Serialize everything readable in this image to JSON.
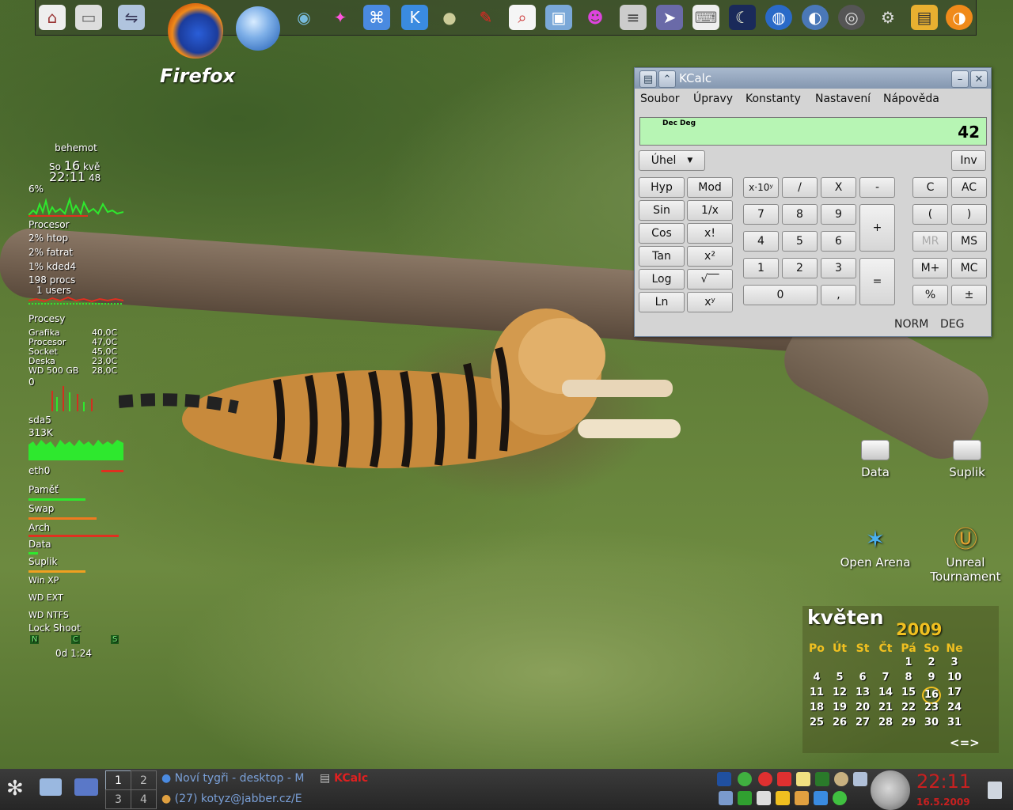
{
  "desktop": {
    "firefox_label": "Firefox",
    "icons": [
      {
        "label": "Data"
      },
      {
        "label": "Suplik"
      },
      {
        "label": "Open Arena"
      },
      {
        "label": "Unreal Tournament"
      }
    ]
  },
  "conky": {
    "host": "behemot",
    "day": "So",
    "daynum": "16",
    "month": "kvě",
    "time": "22:11",
    "seconds": "48",
    "cpu_percent": "6%",
    "cpu_label": "Procesor",
    "processes": [
      "2% htop",
      "2% fatrat",
      "1% kded4"
    ],
    "procs": "198 procs",
    "users": "1 users",
    "procesy_label": "Procesy",
    "temps": [
      {
        "name": "Grafika",
        "value": "40,0C"
      },
      {
        "name": "Procesor",
        "value": "47,0C"
      },
      {
        "name": "Socket",
        "value": "45,0C"
      },
      {
        "name": "Deska",
        "value": "23,0C"
      },
      {
        "name": "WD 500 GB",
        "value": "28,0C"
      }
    ],
    "disk_zero": "0",
    "sda_label": "sda5",
    "sda_rate": "313K",
    "eth_label": "eth0",
    "mounts": [
      {
        "name": "Paměť",
        "fill": 0.6
      },
      {
        "name": "Swap",
        "fill": 0.72
      },
      {
        "name": "Arch",
        "fill": 0.95
      },
      {
        "name": "Data",
        "fill": 0.1
      },
      {
        "name": "Suplik",
        "fill": 0.6
      },
      {
        "name": "Win XP",
        "fill": 0.0
      },
      {
        "name": "WD EXT",
        "fill": 0.0
      },
      {
        "name": "WD NTFS",
        "fill": 0.0
      }
    ],
    "lock_shoot": "Lock  Shoot",
    "keys": [
      "N",
      "C",
      "S"
    ],
    "uptime": "0d  1:24"
  },
  "kcalc": {
    "title": "KCalc",
    "menu": [
      "Soubor",
      "Úpravy",
      "Konstanty",
      "Nastavení",
      "Nápověda"
    ],
    "display_mode": "Dec  Deg",
    "display_value": "42",
    "angle_select": "Úhel",
    "inv": "Inv",
    "sci_left": [
      "Hyp",
      "Sin",
      "Cos",
      "Tan",
      "Log",
      "Ln"
    ],
    "sci_right": [
      "Mod",
      "1/x",
      "x!",
      "x²",
      "√‾‾",
      "xʸ"
    ],
    "exp": "x·10ʸ",
    "ops": [
      "/",
      "X",
      "-",
      "+",
      "="
    ],
    "digits": [
      "7",
      "8",
      "9",
      "4",
      "5",
      "6",
      "1",
      "2",
      "3",
      "0",
      ","
    ],
    "right_keys": [
      "C",
      "AC",
      "(",
      ")",
      "MR",
      "MS",
      "M+",
      "MC",
      "%",
      "±"
    ],
    "status_norm": "NORM",
    "status_deg": "DEG"
  },
  "calendar": {
    "month": "květen",
    "year": "2009",
    "weekdays": [
      "Po",
      "Út",
      "St",
      "Čt",
      "Pá",
      "So",
      "Ne"
    ],
    "weeks": [
      [
        "",
        "",
        "",
        "",
        "1",
        "2",
        "3"
      ],
      [
        "4",
        "5",
        "6",
        "7",
        "8",
        "9",
        "10"
      ],
      [
        "11",
        "12",
        "13",
        "14",
        "15",
        "16",
        "17"
      ],
      [
        "18",
        "19",
        "20",
        "21",
        "22",
        "23",
        "24"
      ],
      [
        "25",
        "26",
        "27",
        "28",
        "29",
        "30",
        "31"
      ]
    ],
    "today": "16",
    "nav": "<=>"
  },
  "taskbar": {
    "pager": [
      "1",
      "2",
      "3",
      "4"
    ],
    "tasks": [
      {
        "label": "Noví tygři - desktop - M"
      },
      {
        "label": "KCalc"
      },
      {
        "label": "(27) kotyz@jabber.cz/E"
      }
    ],
    "clock_time": "22:11",
    "clock_date": "16.5.2009"
  },
  "colors": {
    "accent_kde": "#8497b0",
    "calc_display": "#b7f5b4",
    "clock": "#c82020",
    "calendar_gold": "#f0c020"
  }
}
